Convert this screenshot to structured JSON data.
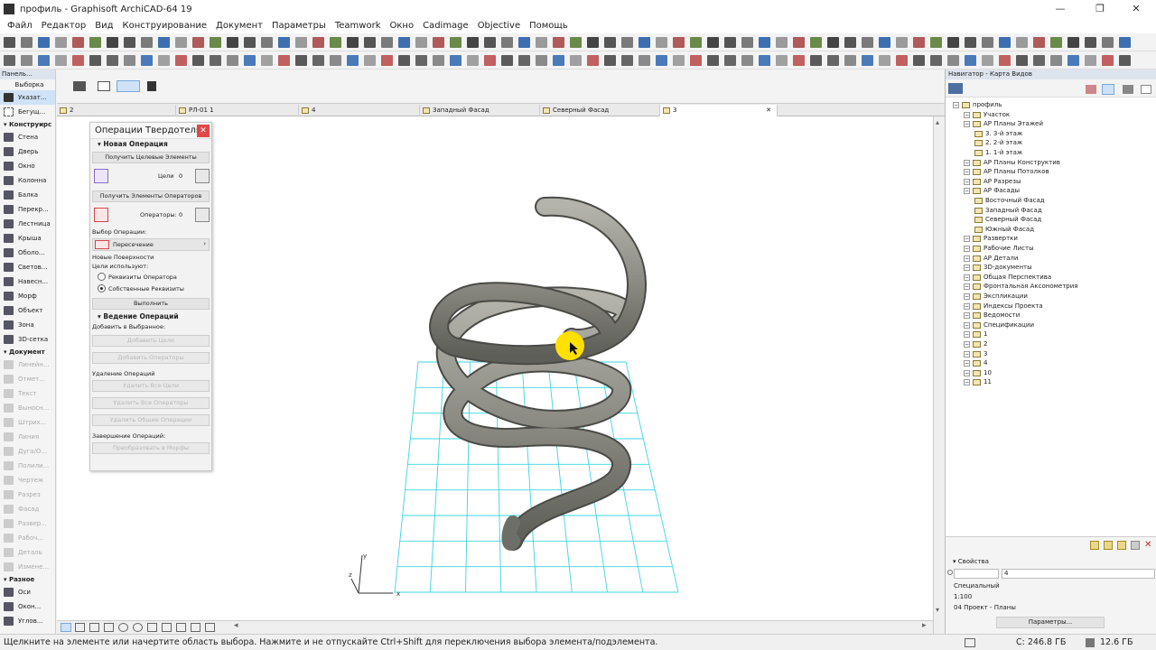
{
  "window": {
    "title": "профиль - Graphisoft ArchiCAD-64 19"
  },
  "menu": [
    "Файл",
    "Редактор",
    "Вид",
    "Конструирование",
    "Документ",
    "Параметры",
    "Teamwork",
    "Окно",
    "Cadimage",
    "Objective",
    "Помощь"
  ],
  "palette": {
    "title": "Панель...",
    "select_group": "Выборка",
    "items_top": [
      {
        "label": "Указат...",
        "selected": true
      },
      {
        "label": "Бегущ..."
      }
    ],
    "construct_group": "Конструирс",
    "construct_items": [
      "Стена",
      "Дверь",
      "Окно",
      "Колонна",
      "Балка",
      "Перекр...",
      "Лестница",
      "Крыша",
      "Оболо...",
      "Светов...",
      "Навесн...",
      "Морф",
      "Объект",
      "Зона",
      "3D-сетка"
    ],
    "document_group": "Документ",
    "document_items": [
      "Линейн...",
      "Отмет...",
      "Текст",
      "Выносн...",
      "Штрих...",
      "Линия",
      "Дуга/О...",
      "Полили...",
      "Чертеж",
      "Разрез",
      "Фасад",
      "Развер...",
      "Рабоч...",
      "Деталь",
      "Измене..."
    ],
    "misc_group": "Разное",
    "misc_items": [
      "Оси",
      "Окон...",
      "Углов..."
    ]
  },
  "tabs": [
    {
      "label": "2"
    },
    {
      "label": "РЛ-01 1"
    },
    {
      "label": "4"
    },
    {
      "label": "Западный Фасад"
    },
    {
      "label": "Северный Фасад"
    },
    {
      "label": "3",
      "active": true
    }
  ],
  "solid_panel": {
    "title": "Операции Твердотель...",
    "new_op": "Новая Операция",
    "get_targets": "Получить Целевые Элементы",
    "targets_label": "Цели",
    "targets_count": "0",
    "get_operators": "Получить Элементы Операторов",
    "operators_label": "Операторы:",
    "operators_count": "0",
    "op_choice": "Выбор Операции:",
    "op_value": "Пересечение",
    "new_surfaces": "Новые Поверхности",
    "targets_use": "Цели используют:",
    "radio1": "Реквизиты Оператора",
    "radio2": "Собственные Реквизиты",
    "execute": "Выполнить",
    "manage": "Ведение Операций",
    "add_fav": "Добавить в Выбранное:",
    "add_targets": "Добавить Цели",
    "add_operators": "Добавить Операторы",
    "delete_ops": "Удаление Операций",
    "delete_all_targets": "Удалить Все Цели",
    "delete_all_operators": "Удалить Все Операторы",
    "delete_common": "Удалить Общие Операции",
    "finish_ops": "Завершение Операций:",
    "convert_morph": "Преобразовать в Морфы"
  },
  "navigator": {
    "title": "Навигатор - Карта Видов",
    "tree": [
      {
        "label": "профиль",
        "level": 0
      },
      {
        "label": "Участок",
        "level": 1
      },
      {
        "label": "АР Планы Этажей",
        "level": 1
      },
      {
        "label": "3. 3-й этаж",
        "level": 2
      },
      {
        "label": "2. 2-й этаж",
        "level": 2
      },
      {
        "label": "1. 1-й этаж",
        "level": 2
      },
      {
        "label": "АР Планы Конструктив",
        "level": 1
      },
      {
        "label": "АР Планы Потолков",
        "level": 1
      },
      {
        "label": "АР Разрезы",
        "level": 1
      },
      {
        "label": "АР Фасады",
        "level": 1
      },
      {
        "label": "Восточный Фасад",
        "level": 2
      },
      {
        "label": "Западный Фасад",
        "level": 2
      },
      {
        "label": "Северный Фасад",
        "level": 2
      },
      {
        "label": "Южный Фасад",
        "level": 2
      },
      {
        "label": "Развертки",
        "level": 1
      },
      {
        "label": "Рабочие Листы",
        "level": 1
      },
      {
        "label": "АР Детали",
        "level": 1
      },
      {
        "label": "3D-документы",
        "level": 1
      },
      {
        "label": "Общая Перспектива",
        "level": 1
      },
      {
        "label": "Фронтальная Аксонометрия",
        "level": 1
      },
      {
        "label": "Экспликации",
        "level": 1
      },
      {
        "label": "Индексы Проекта",
        "level": 1
      },
      {
        "label": "Ведомости",
        "level": 1
      },
      {
        "label": "Спецификации",
        "level": 1
      },
      {
        "label": "1",
        "level": 1
      },
      {
        "label": "2",
        "level": 1
      },
      {
        "label": "3",
        "level": 1
      },
      {
        "label": "4",
        "level": 1
      },
      {
        "label": "10",
        "level": 1
      },
      {
        "label": "11",
        "level": 1
      }
    ]
  },
  "properties": {
    "title": "Свойства",
    "field_value": "4",
    "special": "Специальный",
    "scale": "1:100",
    "project": "04 Проект - Планы",
    "params_button": "Параметры..."
  },
  "status": {
    "hint": "Щелкните на элементе или начертите область выбора. Нажмите и не отпускайте Ctrl+Shift для переключения выбора элемента/подэлемента.",
    "disk1": "C: 246.8 ГБ",
    "disk2": "12.6 ГБ"
  },
  "axes": {
    "x": "x",
    "y": "y",
    "z": "z"
  },
  "colors": {
    "grid": "#39d6e0",
    "spring": "#8f8f88",
    "cursor_highlight": "#ffe000",
    "close": "#e04848"
  }
}
